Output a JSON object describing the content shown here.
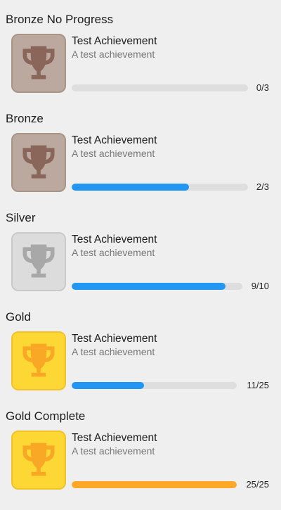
{
  "colors": {
    "progress_active": "#2196f3",
    "progress_complete": "#ffa726",
    "track": "#dedede"
  },
  "sections": [
    {
      "title": "Bronze No Progress",
      "tier": "bronze",
      "icon": "trophy-icon",
      "achievement": {
        "title": "Test Achievement",
        "description": "A test achievement"
      },
      "progress": {
        "current": 0,
        "total": 3,
        "label": "0/3",
        "complete": false
      }
    },
    {
      "title": "Bronze",
      "tier": "bronze",
      "icon": "trophy-icon",
      "achievement": {
        "title": "Test Achievement",
        "description": "A test achievement"
      },
      "progress": {
        "current": 2,
        "total": 3,
        "label": "2/3",
        "complete": false
      }
    },
    {
      "title": "Silver",
      "tier": "silver",
      "icon": "trophy-icon",
      "achievement": {
        "title": "Test Achievement",
        "description": "A test achievement"
      },
      "progress": {
        "current": 9,
        "total": 10,
        "label": "9/10",
        "complete": false
      }
    },
    {
      "title": "Gold",
      "tier": "gold",
      "icon": "trophy-icon",
      "achievement": {
        "title": "Test Achievement",
        "description": "A test achievement"
      },
      "progress": {
        "current": 11,
        "total": 25,
        "label": "11/25",
        "complete": false
      }
    },
    {
      "title": "Gold Complete",
      "tier": "gold",
      "icon": "trophy-icon",
      "achievement": {
        "title": "Test Achievement",
        "description": "A test achievement"
      },
      "progress": {
        "current": 25,
        "total": 25,
        "label": "25/25",
        "complete": true
      }
    }
  ],
  "tiers": {
    "bronze": {
      "bg": "#bba99f",
      "border": "#a99587",
      "trophy": "#8a6559"
    },
    "silver": {
      "bg": "#dcdcdc",
      "border": "#c9c9c9",
      "trophy": "#a8a8a8"
    },
    "gold": {
      "bg": "#fdd835",
      "border": "#f2c22a",
      "trophy": "#f9a825"
    }
  }
}
